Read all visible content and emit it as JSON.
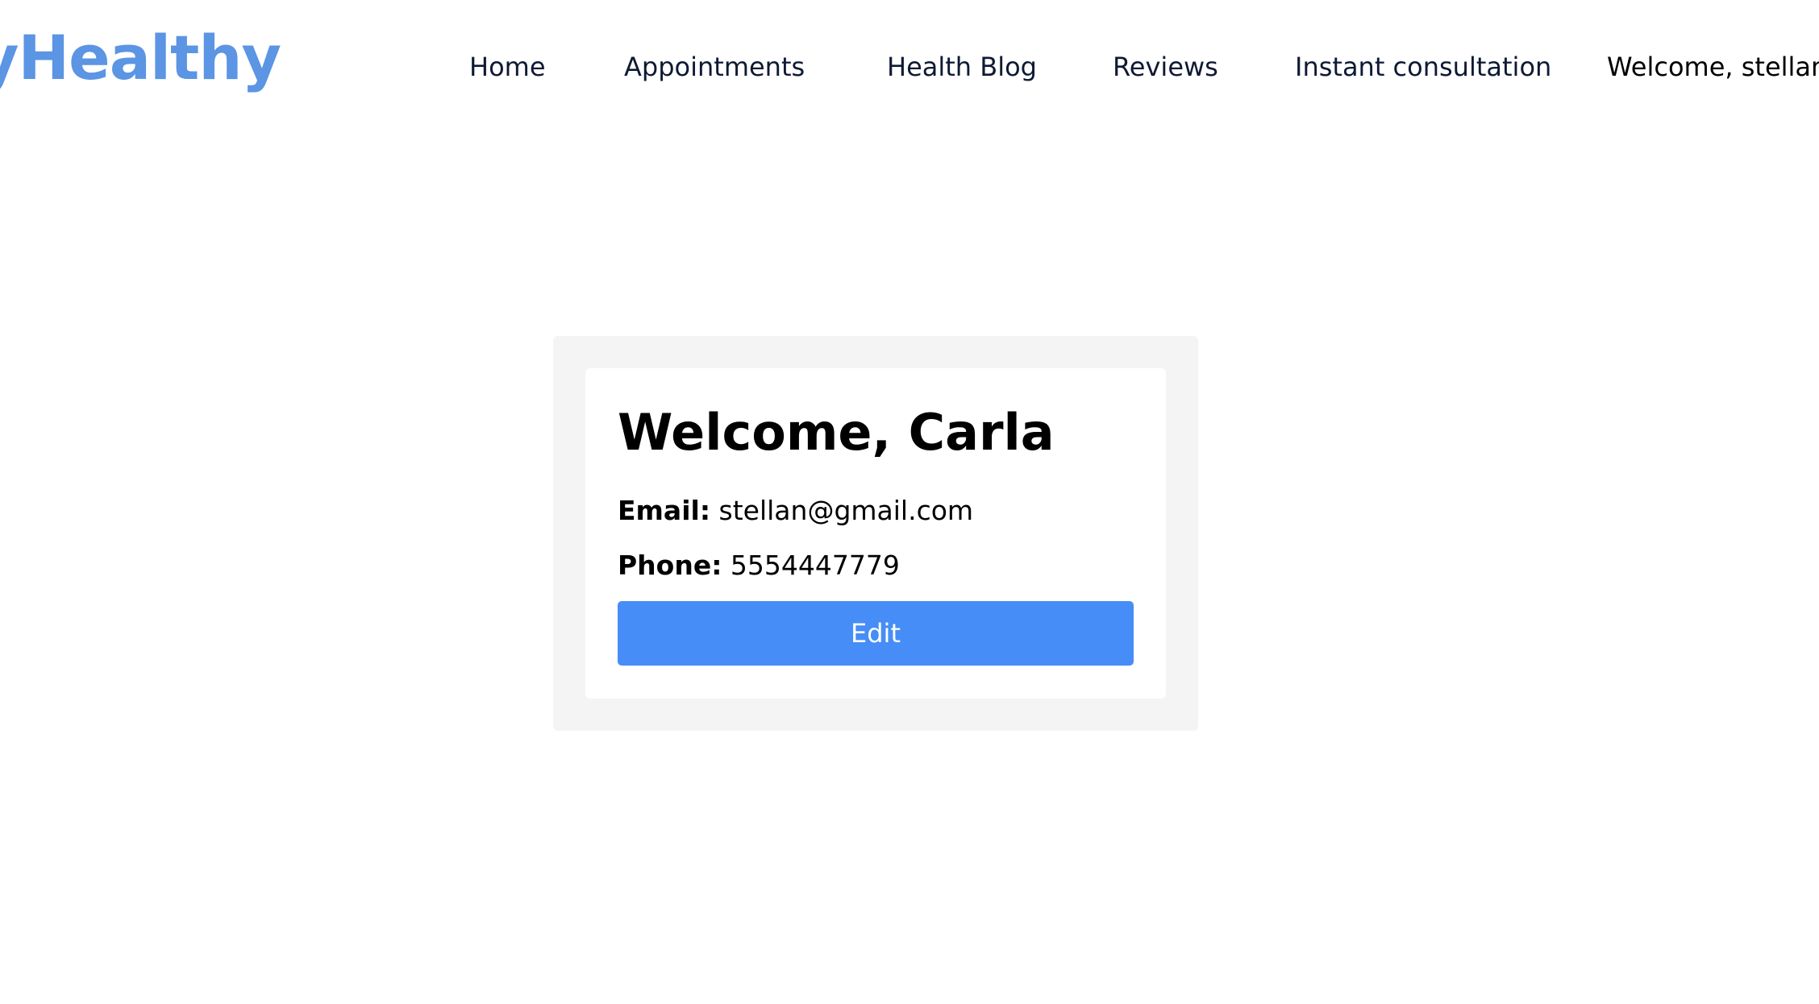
{
  "header": {
    "logo_text": "yHealthy",
    "nav": {
      "home": "Home",
      "appointments": "Appointments",
      "health_blog": "Health Blog",
      "reviews": "Reviews",
      "instant_consultation": "Instant consultation",
      "welcome_user": "Welcome, stellan"
    }
  },
  "profile": {
    "title": "Welcome, Carla",
    "email_label": "Email:",
    "email_value": "stellan@gmail.com",
    "phone_label": "Phone:",
    "phone_value": "5554447779",
    "edit_label": "Edit"
  },
  "colors": {
    "brand_blue": "#5b95e3",
    "button_blue": "#468df7",
    "card_bg": "#f4f4f4"
  }
}
